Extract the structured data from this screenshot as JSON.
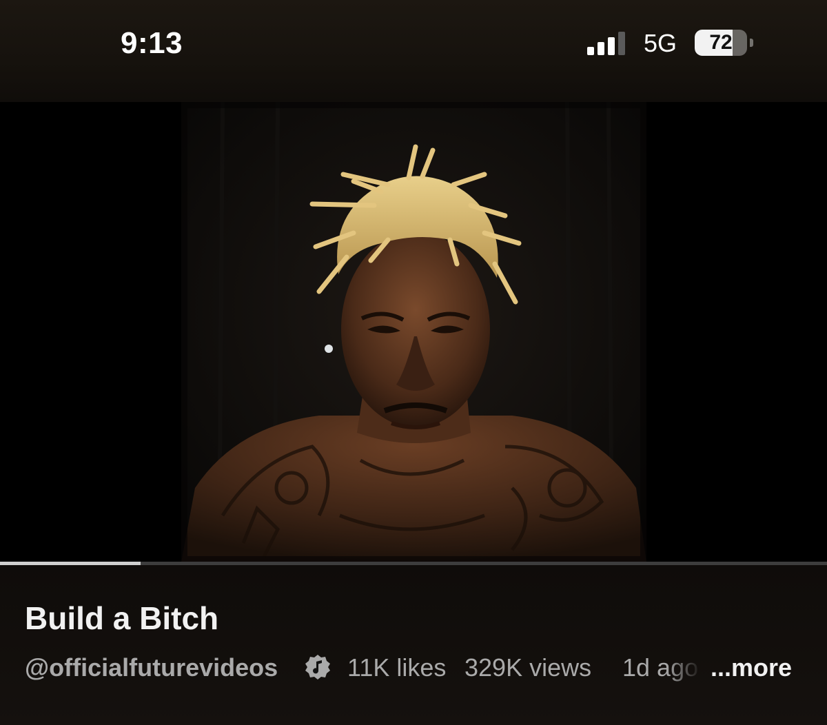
{
  "status_bar": {
    "time": "9:13",
    "network": "5G",
    "battery_level": "72",
    "battery_fraction": 0.72,
    "signal_bars_filled": 3,
    "signal_bars_total": 4
  },
  "video": {
    "thumbnail": "portrait-photo-blond-locs-tattooed-man",
    "progress_fraction": 0.17
  },
  "info": {
    "title": "Build a Bitch",
    "channel_handle": "@officialfuturevideos",
    "badge_icon": "music-note-badge-icon",
    "likes": "11K likes",
    "views": "329K views",
    "age": "1d ago",
    "more_label": "...more"
  },
  "colors": {
    "background": "#000000",
    "panel": "#120f0c",
    "meta_text": "#aaaaaa",
    "title_text": "#f1f1f1"
  }
}
